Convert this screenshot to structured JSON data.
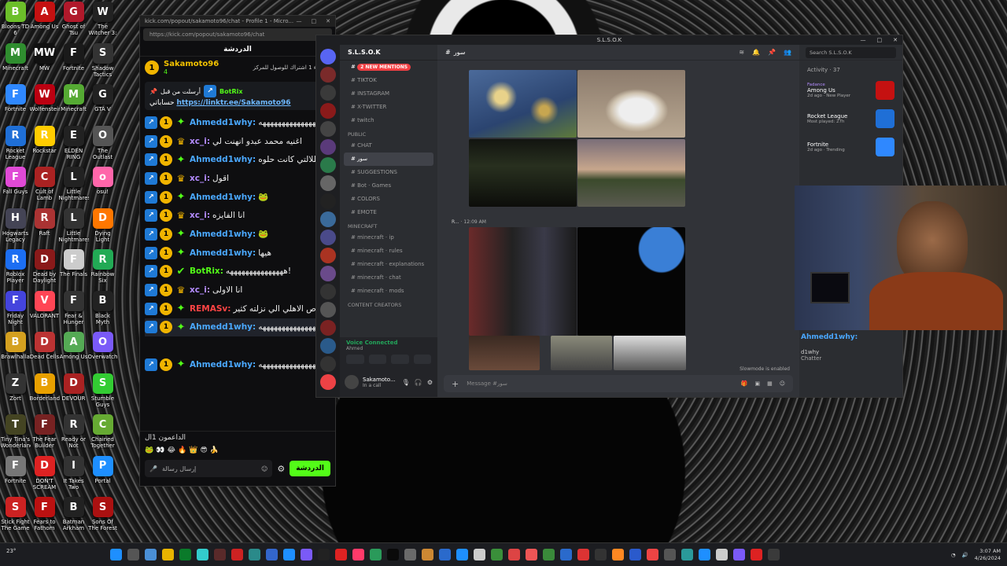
{
  "desktop_icons": [
    {
      "label": "Bloons TD 6",
      "color": "#6cbf2a",
      "glyph": "B"
    },
    {
      "label": "Among Us",
      "color": "#c51111",
      "glyph": "A"
    },
    {
      "label": "Ghost of Tsu",
      "color": "#b0192b",
      "glyph": "G"
    },
    {
      "label": "The Witcher 3: Wild Hunt",
      "color": "#222",
      "glyph": "W"
    },
    {
      "label": "Minecraft",
      "color": "#2f8d2f",
      "glyph": "M"
    },
    {
      "label": "MW",
      "color": "#111",
      "glyph": "MW"
    },
    {
      "label": "Fortnite",
      "color": "#1a1a1a",
      "glyph": "F"
    },
    {
      "label": "Shadow Tactics",
      "color": "#333",
      "glyph": "S"
    },
    {
      "label": "Fortnite",
      "color": "#2f88ff",
      "glyph": "F"
    },
    {
      "label": "Wolfenstein",
      "color": "#b01",
      "glyph": "W"
    },
    {
      "label": "Minecraft",
      "color": "#5a3",
      "glyph": "M"
    },
    {
      "label": "GTA V",
      "color": "#222",
      "glyph": "G"
    },
    {
      "label": "Rocket League",
      "color": "#1f6fd6",
      "glyph": "R"
    },
    {
      "label": "Rockstar",
      "color": "#ffcc00",
      "glyph": "R"
    },
    {
      "label": "ELDEN RING",
      "color": "#222",
      "glyph": "E"
    },
    {
      "label": "The Outlast Trials",
      "color": "#555",
      "glyph": "O"
    },
    {
      "label": "Fall Guys",
      "color": "#e04ad6",
      "glyph": "F"
    },
    {
      "label": "Cult of Lamb",
      "color": "#aa2222",
      "glyph": "C"
    },
    {
      "label": "Little Nightmares",
      "color": "#222",
      "glyph": "L"
    },
    {
      "label": "osu!",
      "color": "#ff66aa",
      "glyph": "o"
    },
    {
      "label": "Hogwarts Legacy",
      "color": "#445",
      "glyph": "H"
    },
    {
      "label": "Raft",
      "color": "#a33",
      "glyph": "R"
    },
    {
      "label": "Little Nightmares II",
      "color": "#333",
      "glyph": "L"
    },
    {
      "label": "Dying Light",
      "color": "#ff7700",
      "glyph": "D"
    },
    {
      "label": "Roblox Player",
      "color": "#1c6ef2",
      "glyph": "R"
    },
    {
      "label": "Dead by Daylight",
      "color": "#8a1a1a",
      "glyph": "D"
    },
    {
      "label": "The Finals",
      "color": "#ccc",
      "glyph": "F"
    },
    {
      "label": "Rainbow Six",
      "color": "#2a5",
      "glyph": "R"
    },
    {
      "label": "Friday Night",
      "color": "#44d",
      "glyph": "F"
    },
    {
      "label": "VALORANT",
      "color": "#ff4655",
      "glyph": "V"
    },
    {
      "label": "Fear & Hunger",
      "color": "#333",
      "glyph": "F"
    },
    {
      "label": "Black Myth",
      "color": "#222",
      "glyph": "B"
    },
    {
      "label": "Brawlhalla",
      "color": "#d4a020",
      "glyph": "B"
    },
    {
      "label": "Dead Cells",
      "color": "#b33",
      "glyph": "D"
    },
    {
      "label": "Among Us",
      "color": "#5a5",
      "glyph": "A"
    },
    {
      "label": "Overwatch",
      "color": "#7a5af8",
      "glyph": "O"
    },
    {
      "label": "Zort",
      "color": "#333",
      "glyph": "Z"
    },
    {
      "label": "Borderlands",
      "color": "#e8a000",
      "glyph": "B"
    },
    {
      "label": "DEVOUR",
      "color": "#a22",
      "glyph": "D"
    },
    {
      "label": "Stumble Guys",
      "color": "#3c3",
      "glyph": "S"
    },
    {
      "label": "Tiny Tina's Wonderlands",
      "color": "#442",
      "glyph": "T"
    },
    {
      "label": "The Fear Builder",
      "color": "#722",
      "glyph": "F"
    },
    {
      "label": "Ready or Not",
      "color": "#333",
      "glyph": "R"
    },
    {
      "label": "Chained Together",
      "color": "#6a3",
      "glyph": "C"
    },
    {
      "label": "Fortnite",
      "color": "#777",
      "glyph": "F"
    },
    {
      "label": "DON'T SCREAM",
      "color": "#d22",
      "glyph": "D"
    },
    {
      "label": "It Takes Two",
      "color": "#333",
      "glyph": "I"
    },
    {
      "label": "Portal",
      "color": "#1e8fff",
      "glyph": "P"
    },
    {
      "label": "Stick Fight The Game",
      "color": "#c22",
      "glyph": "S"
    },
    {
      "label": "Fears to Fathom",
      "color": "#b11",
      "glyph": "F"
    },
    {
      "label": "Batman Arkham",
      "color": "#222",
      "glyph": "B"
    },
    {
      "label": "Sons Of The Forest",
      "color": "#a11",
      "glyph": "S"
    }
  ],
  "kick": {
    "url": "kick.com/popout/sakamoto96/chat - Profile 1 - Micro...",
    "address": "https://kick.com/popout/sakamoto96/chat",
    "header": "الدردشة",
    "streamer": "Sakamoto96",
    "sub_count": "4",
    "tip": "2 إهداء 1 اشتراك للوصول للمركز",
    "pinned_label": "أرسلت من قبل",
    "pinned_user": "BotRix",
    "pinned_text": "حساباتي",
    "pinned_link": "https://linktr.ee/Sakamoto96",
    "messages": [
      {
        "user": "Ahmedd1why:",
        "color": "#4aa8ff",
        "badges": [
          "blue",
          "gold",
          "green"
        ],
        "text": "ههههههههههههههههههههههههه"
      },
      {
        "user": "xc_i:",
        "color": "#b48cff",
        "badges": [
          "blue",
          "gold",
          "crown"
        ],
        "text": "اغنيه محمد عبدو انهنت لي"
      },
      {
        "user": "Ahmedd1why:",
        "color": "#4aa8ff",
        "badges": [
          "blue",
          "gold",
          "green"
        ],
        "text": "طلالتي كانت حلوه"
      },
      {
        "user": "xc_i:",
        "color": "#b48cff",
        "badges": [
          "blue",
          "gold",
          "crown"
        ],
        "text": "اقول"
      },
      {
        "user": "Ahmedd1why:",
        "color": "#4aa8ff",
        "badges": [
          "blue",
          "gold",
          "green"
        ],
        "text": "🐸"
      },
      {
        "user": "xc_i:",
        "color": "#b48cff",
        "badges": [
          "blue",
          "gold",
          "crown"
        ],
        "text": "انا الفايزه"
      },
      {
        "user": "Ahmedd1why:",
        "color": "#4aa8ff",
        "badges": [
          "blue",
          "gold",
          "green"
        ],
        "text": "🐸"
      },
      {
        "user": "Ahmedd1why:",
        "color": "#4aa8ff",
        "badges": [
          "blue",
          "gold",
          "green"
        ],
        "text": "هيها"
      },
      {
        "user": "BotRix:",
        "color": "#53fc18",
        "badges": [
          "blue",
          "gold",
          "check"
        ],
        "text": "هههههههههههههههه!"
      },
      {
        "user": "xc_i:",
        "color": "#b48cff",
        "badges": [
          "blue",
          "gold",
          "crown"
        ],
        "text": "انا الاولى"
      },
      {
        "user": "REMASv:",
        "color": "#ff4444",
        "badges": [
          "blue",
          "gold",
          "green"
        ],
        "text": "عوص الاهلي الي نزلته كثير"
      },
      {
        "user": "Ahmedd1why:",
        "color": "#4aa8ff",
        "badges": [
          "blue",
          "gold",
          "green"
        ],
        "text": "ههههههههههههههههههههههههه"
      },
      {
        "user": "",
        "color": "#4aa8ff",
        "badges": [],
        "text": ""
      },
      {
        "user": "Ahmedd1why:",
        "color": "#4aa8ff",
        "badges": [
          "blue",
          "gold",
          "green"
        ],
        "text": "ههههههههههههههههههههههههه"
      }
    ],
    "supporters_label": "الداعمون 1ال",
    "send_placeholder": "إرسال رسالة",
    "send_button": "الدردشة"
  },
  "discord": {
    "title": "S.L.S.O.K",
    "server_name": "S.L.S.O.K",
    "channels_top": [
      {
        "name": "2 NEW MENTIONS",
        "mention": true
      },
      {
        "name": "TIKTOK"
      },
      {
        "name": "INSTAGRAM"
      },
      {
        "name": "X-TWITTER"
      },
      {
        "name": "twitch"
      }
    ],
    "cat_public": "PUBLIC",
    "channels_public": [
      {
        "name": "CHAT"
      },
      {
        "name": "سور",
        "sel": true
      },
      {
        "name": "SUGGESTIONS"
      },
      {
        "name": "Bot · Games"
      },
      {
        "name": "COLORS"
      },
      {
        "name": "EMOTE"
      }
    ],
    "cat_minecraft": "Minecraft",
    "channels_minecraft": [
      {
        "name": "minecraft · ip"
      },
      {
        "name": "minecraft · rules"
      },
      {
        "name": "minecraft · explanations"
      },
      {
        "name": "minecraft · chat"
      },
      {
        "name": "minecraft · mods"
      }
    ],
    "cat_creators": "CONTENT CREATORS",
    "voice_status": "Voice Connected",
    "voice_sub": "Ahmed",
    "user": "Sakamoto...",
    "user_status": "In a call",
    "channel_header": "سور",
    "msg_time1": "12:09 AM",
    "msg_author2": "R...",
    "composer": "Message #سور",
    "slowmode": "Slowmode is enabled",
    "search": "Search S.L.S.O.K",
    "activity_title": "Activity",
    "activity_count": "37",
    "activities": [
      {
        "who": "Fadance",
        "game": "Among Us",
        "meta": "2d ago · New Player",
        "color": "#c51111"
      },
      {
        "who": "",
        "game": "Rocket League",
        "meta": "Most played: 27h",
        "color": "#1f6fd6"
      },
      {
        "who": "",
        "game": "Fortnite",
        "meta": "2d ago · Trending",
        "color": "#2f88ff"
      }
    ]
  },
  "overlay": {
    "user": "Ahmedd1why:",
    "line2": "d1why",
    "line3": "Chatter"
  },
  "taskbar": {
    "weather": "23°",
    "time": "3:07 AM",
    "date": "4/26/2024"
  }
}
